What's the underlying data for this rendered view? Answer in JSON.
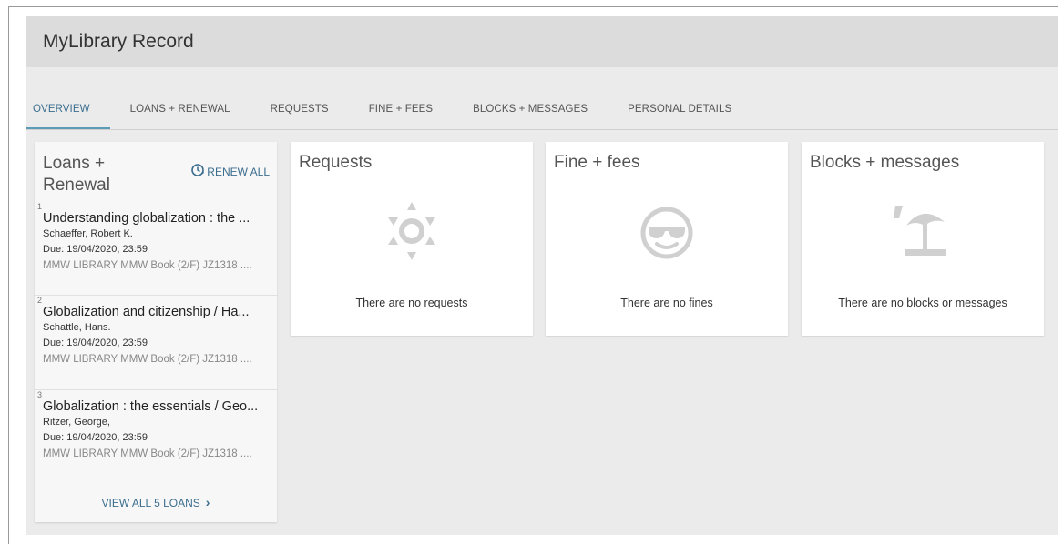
{
  "header": {
    "title": "MyLibrary Record"
  },
  "tabs": [
    {
      "label": "OVERVIEW"
    },
    {
      "label": "LOANS + RENEWAL"
    },
    {
      "label": "REQUESTS"
    },
    {
      "label": "FINE + FEES"
    },
    {
      "label": "BLOCKS + MESSAGES"
    },
    {
      "label": "PERSONAL DETAILS"
    }
  ],
  "active_tab": "OVERVIEW",
  "loans": {
    "title": "Loans + Renewal",
    "renew_all_label": "RENEW ALL",
    "renew_icon": "clock-renew-icon",
    "items": [
      {
        "num": "1",
        "title": "Understanding globalization : the ...",
        "author": "Schaeffer, Robert K.",
        "due": "Due: 19/04/2020, 23:59",
        "location": "MMW LIBRARY MMW Book (2/F) JZ1318 ...."
      },
      {
        "num": "2",
        "title": "Globalization and citizenship / Ha...",
        "author": "Schattle, Hans.",
        "due": "Due: 19/04/2020, 23:59",
        "location": "MMW LIBRARY MMW Book (2/F) JZ1318 ...."
      },
      {
        "num": "3",
        "title": "Globalization : the essentials / Geo...",
        "author": "Ritzer, George,",
        "due": "Due: 19/04/2020, 23:59",
        "location": "MMW LIBRARY MMW Book (2/F) JZ1318 ...."
      }
    ],
    "view_all_label": "VIEW ALL 5 LOANS",
    "view_all_icon": "chevron-right-icon"
  },
  "requests": {
    "title": "Requests",
    "empty_text": "There are no requests",
    "icon": "sun-icon"
  },
  "fines": {
    "title": "Fine + fees",
    "empty_text": "There are no fines",
    "icon": "sunglasses-face-icon"
  },
  "blocks": {
    "title": "Blocks + messages",
    "empty_text": "There are no blocks or messages",
    "icon": "beach-umbrella-icon"
  },
  "colors": {
    "accent": "#3b6e8f",
    "tab_underline": "#5b9bb5",
    "icon_gray": "#d0d0d0",
    "background": "#ebebeb"
  }
}
